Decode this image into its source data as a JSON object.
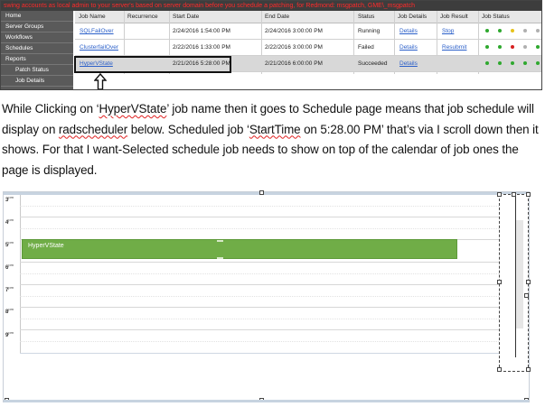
{
  "banner": "swing accounts as local admin to your server's based on server domain before you schedule a patching, for Redmond: msgpatch, GME\\_msgpatch",
  "sidebar": {
    "items": [
      {
        "label": "Home"
      },
      {
        "label": "Server Groups"
      },
      {
        "label": "Workflows"
      },
      {
        "label": "Schedules"
      },
      {
        "label": "Reports"
      },
      {
        "label": "Patch Status"
      },
      {
        "label": "Job Details"
      }
    ]
  },
  "grid": {
    "headers": [
      "Job Name",
      "Recurrence",
      "Start Date",
      "End Date",
      "Status",
      "Job Details",
      "Job Result",
      "Job Status"
    ],
    "rows": [
      {
        "job_name": "SQLFailOver",
        "recurrence": "",
        "start": "2/24/2016 1:54:00 PM",
        "end": "2/24/2016 3:00:00 PM",
        "status": "Running",
        "details": "Details",
        "result": "Stop"
      },
      {
        "job_name": "ClusterfailOver",
        "recurrence": "",
        "start": "2/22/2016 1:33:00 PM",
        "end": "2/22/2016 3:00:00 PM",
        "status": "Failed",
        "details": "Details",
        "result": "Resubmit"
      },
      {
        "job_name": "HyperVState",
        "recurrence": "",
        "start": "2/21/2016 5:28:00 PM",
        "end": "2/21/2016 6:00:00 PM",
        "status": "Succeeded",
        "details": "Details",
        "result": ""
      }
    ],
    "status_dot_colors": {
      "green": "#2ea82e",
      "red": "#d62020",
      "yellow": "#e6c21a",
      "grey": "#b0b0b0"
    }
  },
  "paragraph": {
    "s1": "While Clicking on ‘",
    "s2": "HyperVState",
    "s3": "’ job name then it goes to Schedule page means that job schedule will display on ",
    "s4": "radscheduler",
    "s5": " below. Scheduled job ‘",
    "s6": "StartTime",
    "s7": " on 5:28.00 PM’ that’s via I scroll down then it shows. For that I want-Selected schedule job needs to show on top of the calendar of job ones the page is displayed."
  },
  "scheduler": {
    "hours": [
      {
        "h": "3",
        "ap": "pm"
      },
      {
        "h": "4",
        "ap": "pm"
      },
      {
        "h": "5",
        "ap": "pm"
      },
      {
        "h": "6",
        "ap": "pm"
      },
      {
        "h": "7",
        "ap": "pm"
      },
      {
        "h": "8",
        "ap": "pm"
      },
      {
        "h": "9",
        "ap": "pm"
      }
    ],
    "appointment": "HyperVState",
    "appointment_color": "#70ad47"
  }
}
